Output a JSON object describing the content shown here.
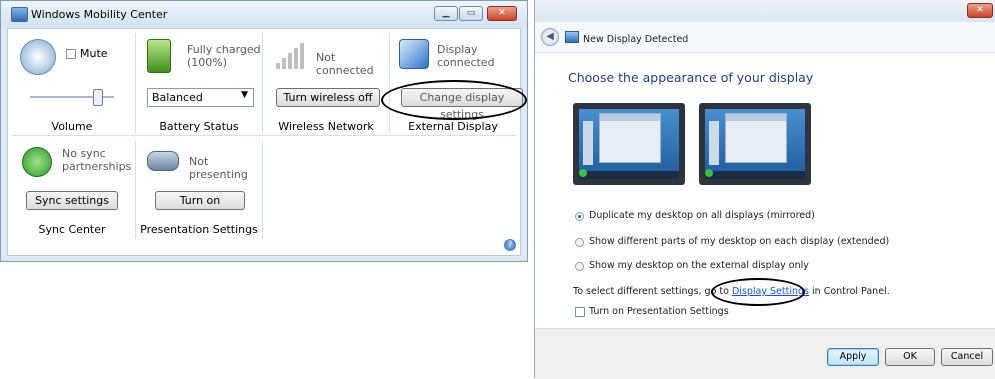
{
  "mobility_center": {
    "title": "Windows Mobility Center",
    "volume": {
      "mute_label": "Mute",
      "tile_label": "Volume",
      "level": 0.8
    },
    "battery": {
      "status": "Fully charged\n(100%)",
      "plan": "Balanced",
      "tile_label": "Battery Status"
    },
    "wireless": {
      "status": "Not connected",
      "button": "Turn wireless off",
      "tile_label": "Wireless Network"
    },
    "display": {
      "status": "Display\nconnected",
      "button": "Change display settings",
      "tile_label": "External Display"
    },
    "sync": {
      "status": "No sync\npartnerships",
      "button": "Sync settings",
      "tile_label": "Sync Center"
    },
    "presentation": {
      "status": "Not presenting",
      "button": "Turn on",
      "tile_label": "Presentation Settings"
    }
  },
  "display_dialog": {
    "title": "New Display Detected",
    "heading": "Choose the appearance of your display",
    "options": [
      {
        "label": "Duplicate my desktop on all displays (mirrored)",
        "selected": true
      },
      {
        "label": "Show different parts of my desktop on each display (extended)",
        "selected": false
      },
      {
        "label": "Show my desktop on the external display only",
        "selected": false
      }
    ],
    "hint_prefix": "To select different settings, go to ",
    "hint_link": "Display Settings",
    "hint_suffix": " in Control Panel.",
    "presentation_checkbox": "Turn on Presentation Settings",
    "buttons": {
      "apply": "Apply",
      "ok": "OK",
      "cancel": "Cancel"
    }
  },
  "colors": {
    "accent": "#1f5fb5",
    "window_frame": "#dfe8f3",
    "link": "#1456c8"
  }
}
